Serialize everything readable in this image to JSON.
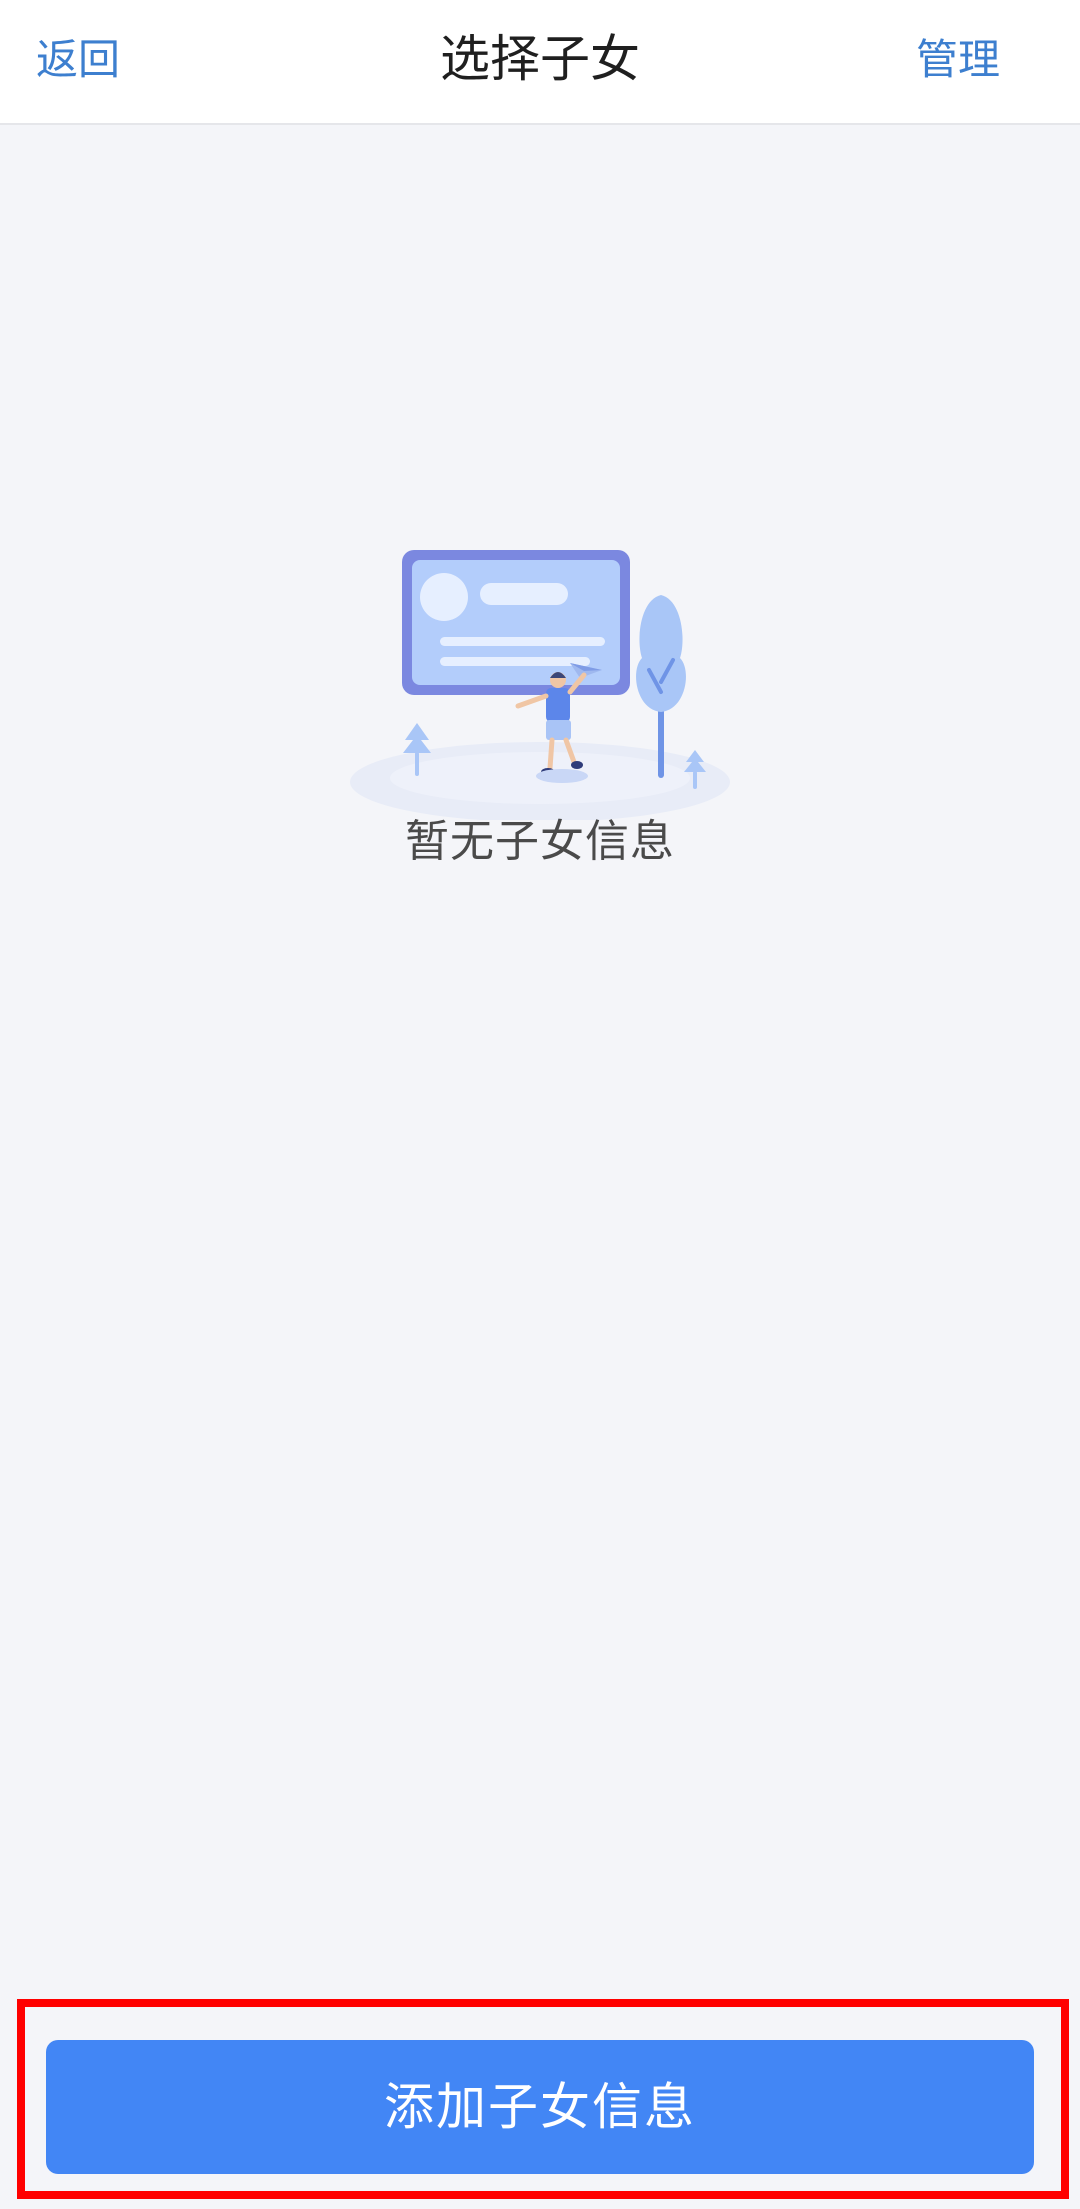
{
  "header": {
    "back_label": "返回",
    "title": "选择子女",
    "manage_label": "管理"
  },
  "empty_state": {
    "message": "暂无子女信息",
    "illustration_icon": "empty-profile-card-illustration"
  },
  "footer": {
    "add_button_label": "添加子女信息"
  },
  "colors": {
    "nav_link": "#3d7fcf",
    "primary_button": "#4286f5",
    "page_background": "#f4f5f9",
    "highlight_frame": "#ff0000"
  }
}
